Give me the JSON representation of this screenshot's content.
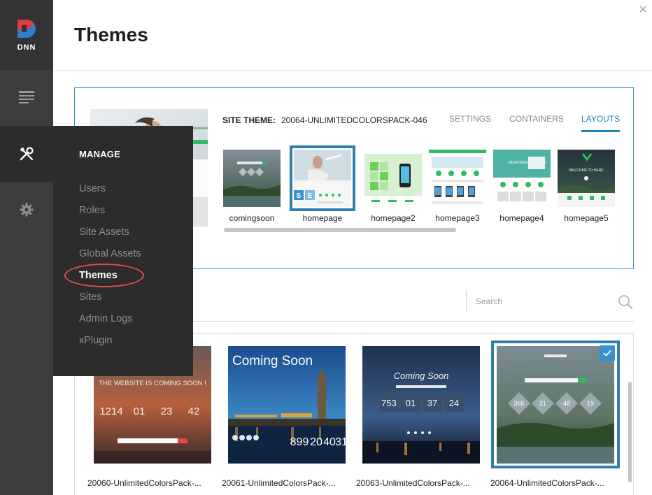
{
  "logo": {
    "text": "DNN"
  },
  "header": {
    "title": "Themes"
  },
  "manage_menu": {
    "title": "MANAGE",
    "items": [
      "Users",
      "Roles",
      "Site Assets",
      "Global Assets",
      "Themes",
      "Sites",
      "Admin Logs",
      "xPlugin"
    ],
    "active": "Themes"
  },
  "site_theme": {
    "label": "SITE THEME:",
    "value": "20064-UNLIMITEDCOLORSPACK-046",
    "tabs": [
      "SETTINGS",
      "CONTAINERS",
      "LAYOUTS"
    ],
    "active_tab": "LAYOUTS"
  },
  "layouts": [
    {
      "name": "comingsoon"
    },
    {
      "name": "homepage",
      "selected": true
    },
    {
      "name": "homepage2"
    },
    {
      "name": "homepage3"
    },
    {
      "name": "homepage4"
    },
    {
      "name": "homepage5"
    }
  ],
  "layout_thumb_texts": {
    "homepage4": "RESPONSIVE DESIGN",
    "homepage5": "WELCOME TO HERE",
    "homepage_badges": [
      "S",
      "E"
    ]
  },
  "search": {
    "placeholder": "Search"
  },
  "themes": [
    {
      "name": "20060-UnlimitedColorsPack-...",
      "headline": "THE WEBSITE IS COMING SOON !",
      "counters": [
        "1214",
        "01",
        "23",
        "42"
      ]
    },
    {
      "name": "20061-UnlimitedColorsPack-...",
      "headline": "Coming Soon",
      "counters": [
        "899",
        "20",
        "40",
        "31"
      ]
    },
    {
      "name": "20063-UnlimitedColorsPack-...",
      "headline": "Coming Soon",
      "counters": [
        "753",
        "01",
        "37",
        "24"
      ]
    },
    {
      "name": "20064-UnlimitedColorsPack-...",
      "headline": "",
      "counters": [
        "365",
        "21",
        "48",
        "19"
      ],
      "selected": true
    }
  ],
  "colors": {
    "accent": "#1e84c8",
    "selection_border": "#2f7fae",
    "rail": "#3d3d3d",
    "flyout": "#2c2c2c",
    "highlight_circle": "#e24a4a"
  }
}
